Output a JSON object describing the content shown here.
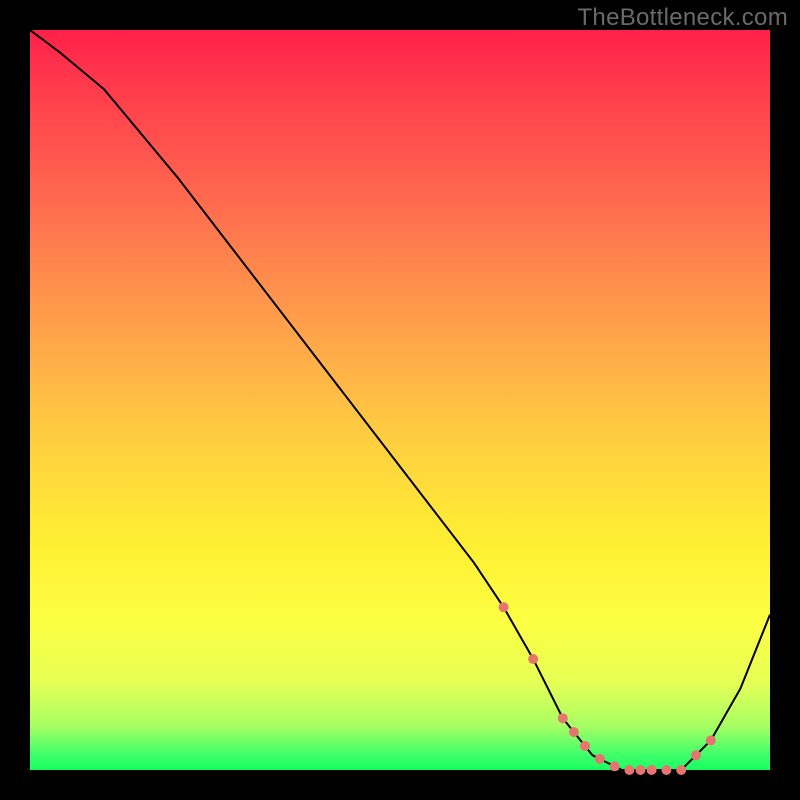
{
  "watermark": "TheBottleneck.com",
  "colors": {
    "dot": "#e6756f",
    "curve": "#000000"
  },
  "chart_data": {
    "type": "line",
    "title": "",
    "xlabel": "",
    "ylabel": "",
    "xlim": [
      0,
      100
    ],
    "ylim": [
      0,
      100
    ],
    "grid": false,
    "x": [
      0,
      4,
      10,
      20,
      30,
      40,
      50,
      60,
      64,
      68,
      72,
      76,
      80,
      84,
      88,
      92,
      96,
      100
    ],
    "values": [
      100,
      97,
      92,
      80,
      67,
      54,
      41,
      28,
      22,
      15,
      7,
      2,
      0,
      0,
      0,
      4,
      11,
      21
    ],
    "optimal_range_x": [
      64,
      92
    ],
    "dot_points_x": [
      64,
      68,
      72,
      73.5,
      75,
      77,
      79,
      81,
      82.5,
      84,
      86,
      88,
      90,
      92
    ],
    "annotations": []
  }
}
